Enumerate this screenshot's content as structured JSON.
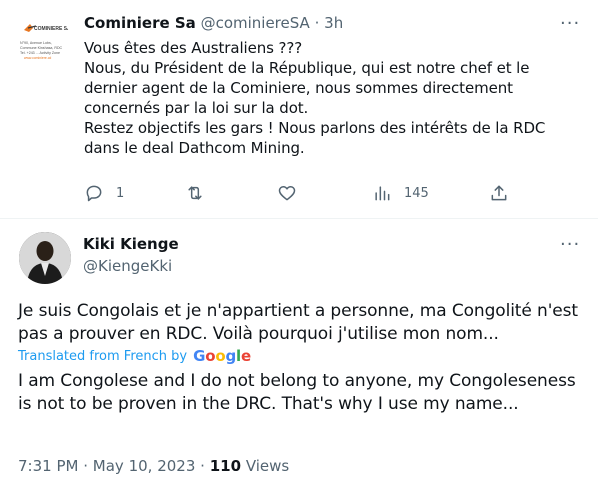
{
  "tweet1": {
    "avatar_lines": [
      "COMINIERE SA",
      "N°90, Avenue Lobs,",
      "Commune Kinshasa, RDC",
      "Tel. +243 ... Activity Zone",
      "www.cominiere.cd"
    ],
    "name": "Cominiere Sa",
    "handle": "@cominiereSA",
    "separator": "·",
    "time": "3h",
    "more_label": "···",
    "body": "Vous êtes  des Australiens ???\nNous, du Président de la République,  qui est notre chef et le dernier agent de la Cominiere,  nous sommes  directement concernés  par la loi sur la dot.\nRestez objectifs les gars ! Nous parlons des intérêts de la RDC dans le deal Dathcom Mining.",
    "actions": {
      "reply_count": "1",
      "retweet_count": "",
      "like_count": "",
      "views_count": "145"
    }
  },
  "tweet2": {
    "name": "Kiki Kienge",
    "handle": "@KiengeKki",
    "more_label": "···",
    "text": "Je suis Congolais et je n'appartient a personne, ma Congolité n'est pas a prouver en RDC. Voilà pourquoi j'utilise mon nom...",
    "translated_label": "Translated from French by",
    "google_letters": [
      "G",
      "o",
      "o",
      "g",
      "l",
      "e"
    ],
    "translation": "I am Congolese and I do not belong to anyone, my Congoleseness is not to be proven in the DRC. That's why I use my name...",
    "time": "7:31 PM",
    "dot": "·",
    "date": "May 10, 2023",
    "dot2": "·",
    "views_count": "110",
    "views_label": "Views"
  },
  "colors": {
    "text": "#0f1419",
    "secondary": "#536471",
    "link": "#1d9bf0",
    "divider": "#eff3f4",
    "accent_orange": "#e87722"
  }
}
